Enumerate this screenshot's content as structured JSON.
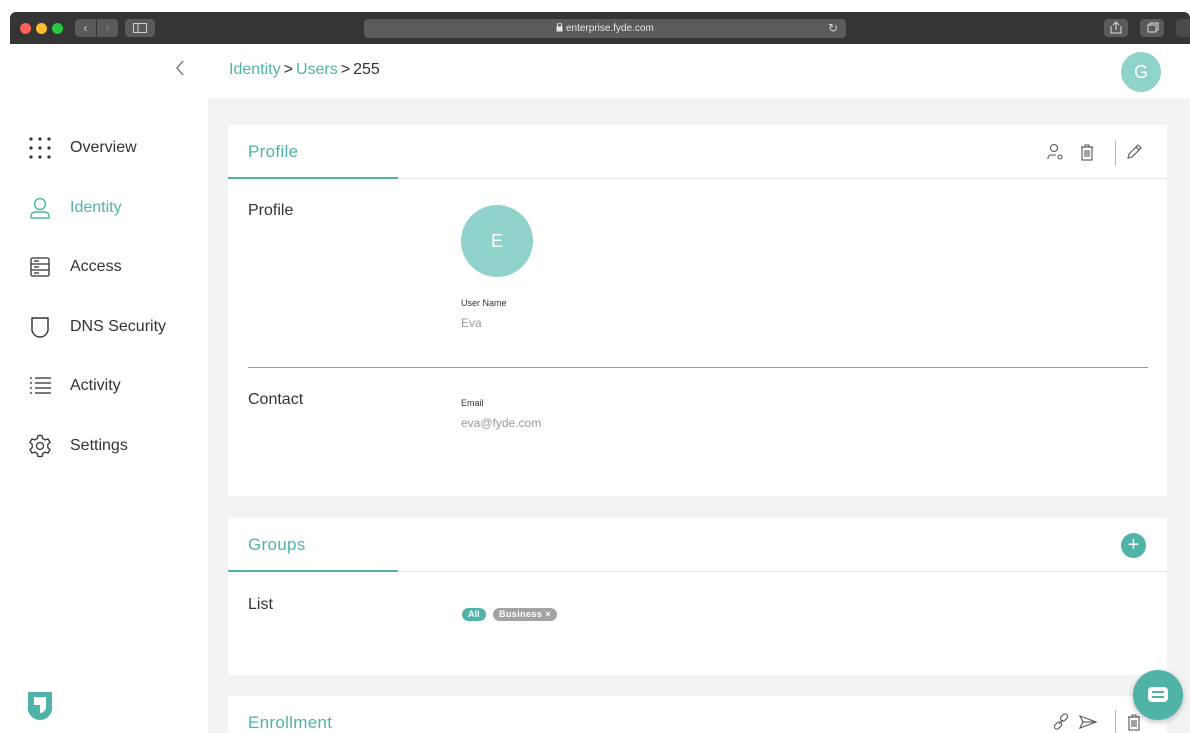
{
  "browser": {
    "address": "enterprise.fyde.com",
    "lock_icon": "lock-icon",
    "reload_icon": "reload-icon"
  },
  "app": {
    "accent_color": "#4fb3a8",
    "avatar_color": "#8fd3ca",
    "user_initial": "G"
  },
  "breadcrumb": {
    "items": [
      {
        "label": "Identity",
        "link": true
      },
      {
        "label": "Users",
        "link": true
      },
      {
        "label": "255",
        "link": false
      }
    ],
    "separator": ">"
  },
  "sidebar": {
    "collapse_icon": "chevron-left-icon",
    "items": [
      {
        "label": "Overview",
        "icon": "grid-dots-icon",
        "active": false
      },
      {
        "label": "Identity",
        "icon": "user-icon",
        "active": true
      },
      {
        "label": "Access",
        "icon": "server-icon",
        "active": false
      },
      {
        "label": "DNS Security",
        "icon": "shield-icon",
        "active": false
      },
      {
        "label": "Activity",
        "icon": "list-icon",
        "active": false
      },
      {
        "label": "Settings",
        "icon": "gear-icon",
        "active": false
      }
    ]
  },
  "profile_card": {
    "title": "Profile",
    "actions": [
      "user-settings-icon",
      "trash-icon",
      "pencil-icon"
    ],
    "profile_section": {
      "label": "Profile",
      "avatar_initial": "E",
      "user_name_label": "User Name",
      "user_name_value": "Eva"
    },
    "contact_section": {
      "label": "Contact",
      "email_label": "Email",
      "email_value": "eva@fyde.com"
    }
  },
  "groups_card": {
    "title": "Groups",
    "add_label": "+",
    "list_label": "List",
    "tags": [
      {
        "label": "All",
        "removable": false
      },
      {
        "label": "Business",
        "removable": true
      }
    ],
    "remove_glyph": "×"
  },
  "enrollment_card": {
    "title": "Enrollment",
    "actions": [
      "link-icon",
      "send-icon",
      "trash-icon"
    ]
  },
  "chat": {
    "icon": "chat-icon"
  }
}
